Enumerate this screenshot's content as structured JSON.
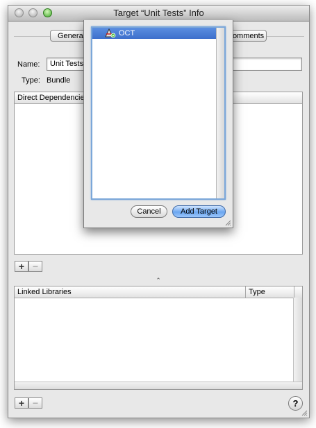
{
  "window": {
    "title": "Target “Unit Tests” Info"
  },
  "tabs": [
    {
      "label": "General"
    },
    {
      "label": "Comments"
    }
  ],
  "fields": {
    "name_label": "Name:",
    "name_value": "Unit Tests",
    "type_label": "Type:",
    "type_value": "Bundle"
  },
  "dependencies_table": {
    "header": "Direct Dependencies"
  },
  "libraries_table": {
    "columns": [
      "Linked Libraries",
      "Type"
    ]
  },
  "buttons": {
    "add": "+",
    "remove": "−",
    "help": "?"
  },
  "sheet": {
    "items": [
      {
        "label": "OCT",
        "selected": true
      }
    ],
    "cancel_label": "Cancel",
    "add_target_label": "Add Target"
  },
  "colors": {
    "selection": "#3d6fcc",
    "default_button": "#6aa6f0",
    "zoom_light": "#3fa82a"
  },
  "icons": {
    "target": "target-app-icon",
    "help": "help-icon"
  }
}
